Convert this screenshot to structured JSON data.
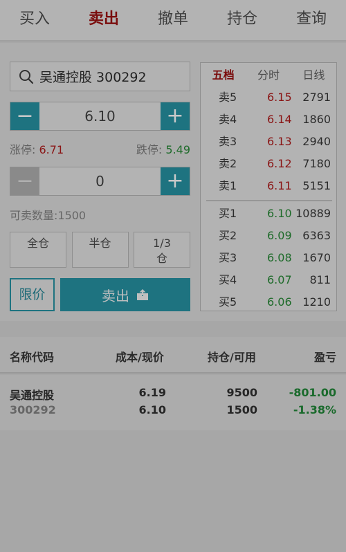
{
  "tabs": [
    {
      "label": "买入",
      "active": false
    },
    {
      "label": "卖出",
      "active": true
    },
    {
      "label": "撤单",
      "active": false
    },
    {
      "label": "持仓",
      "active": false
    },
    {
      "label": "查询",
      "active": false
    }
  ],
  "order": {
    "stock": "吴通控股 300292",
    "price": "6.10",
    "quantity": "0",
    "limit_up_label": "涨停:",
    "limit_up": "6.71",
    "limit_down_label": "跌停:",
    "limit_down": "5.49",
    "sellable": "可卖数量:1500",
    "ratio_buttons": [
      "全仓",
      "半仓",
      "1/3",
      "仓"
    ],
    "limit_label": "限价",
    "sell_label": "卖出"
  },
  "quote": {
    "tabs": [
      "五档",
      "分时",
      "日线"
    ],
    "asks": [
      {
        "label": "卖5",
        "price": "6.15",
        "volume": "2791"
      },
      {
        "label": "卖4",
        "price": "6.14",
        "volume": "1860"
      },
      {
        "label": "卖3",
        "price": "6.13",
        "volume": "2940"
      },
      {
        "label": "卖2",
        "price": "6.12",
        "volume": "7180"
      },
      {
        "label": "卖1",
        "price": "6.11",
        "volume": "5151"
      }
    ],
    "bids": [
      {
        "label": "买1",
        "price": "6.10",
        "volume": "10889"
      },
      {
        "label": "买2",
        "price": "6.09",
        "volume": "6363"
      },
      {
        "label": "买3",
        "price": "6.08",
        "volume": "1670"
      },
      {
        "label": "买4",
        "price": "6.07",
        "volume": "811"
      },
      {
        "label": "买5",
        "price": "6.06",
        "volume": "1210"
      }
    ]
  },
  "holdings": {
    "headers": [
      "名称代码",
      "成本/现价",
      "持仓/可用",
      "盈亏"
    ],
    "row": {
      "name": "吴通控股",
      "code": "300292",
      "cost": "6.19",
      "current": "6.10",
      "position": "9500",
      "available": "1500",
      "pl": "-801.00",
      "pl_pct": "-1.38%"
    }
  },
  "colors": {
    "accent": "#1e7380",
    "up": "#8a1515",
    "down": "#1e6b2a"
  }
}
